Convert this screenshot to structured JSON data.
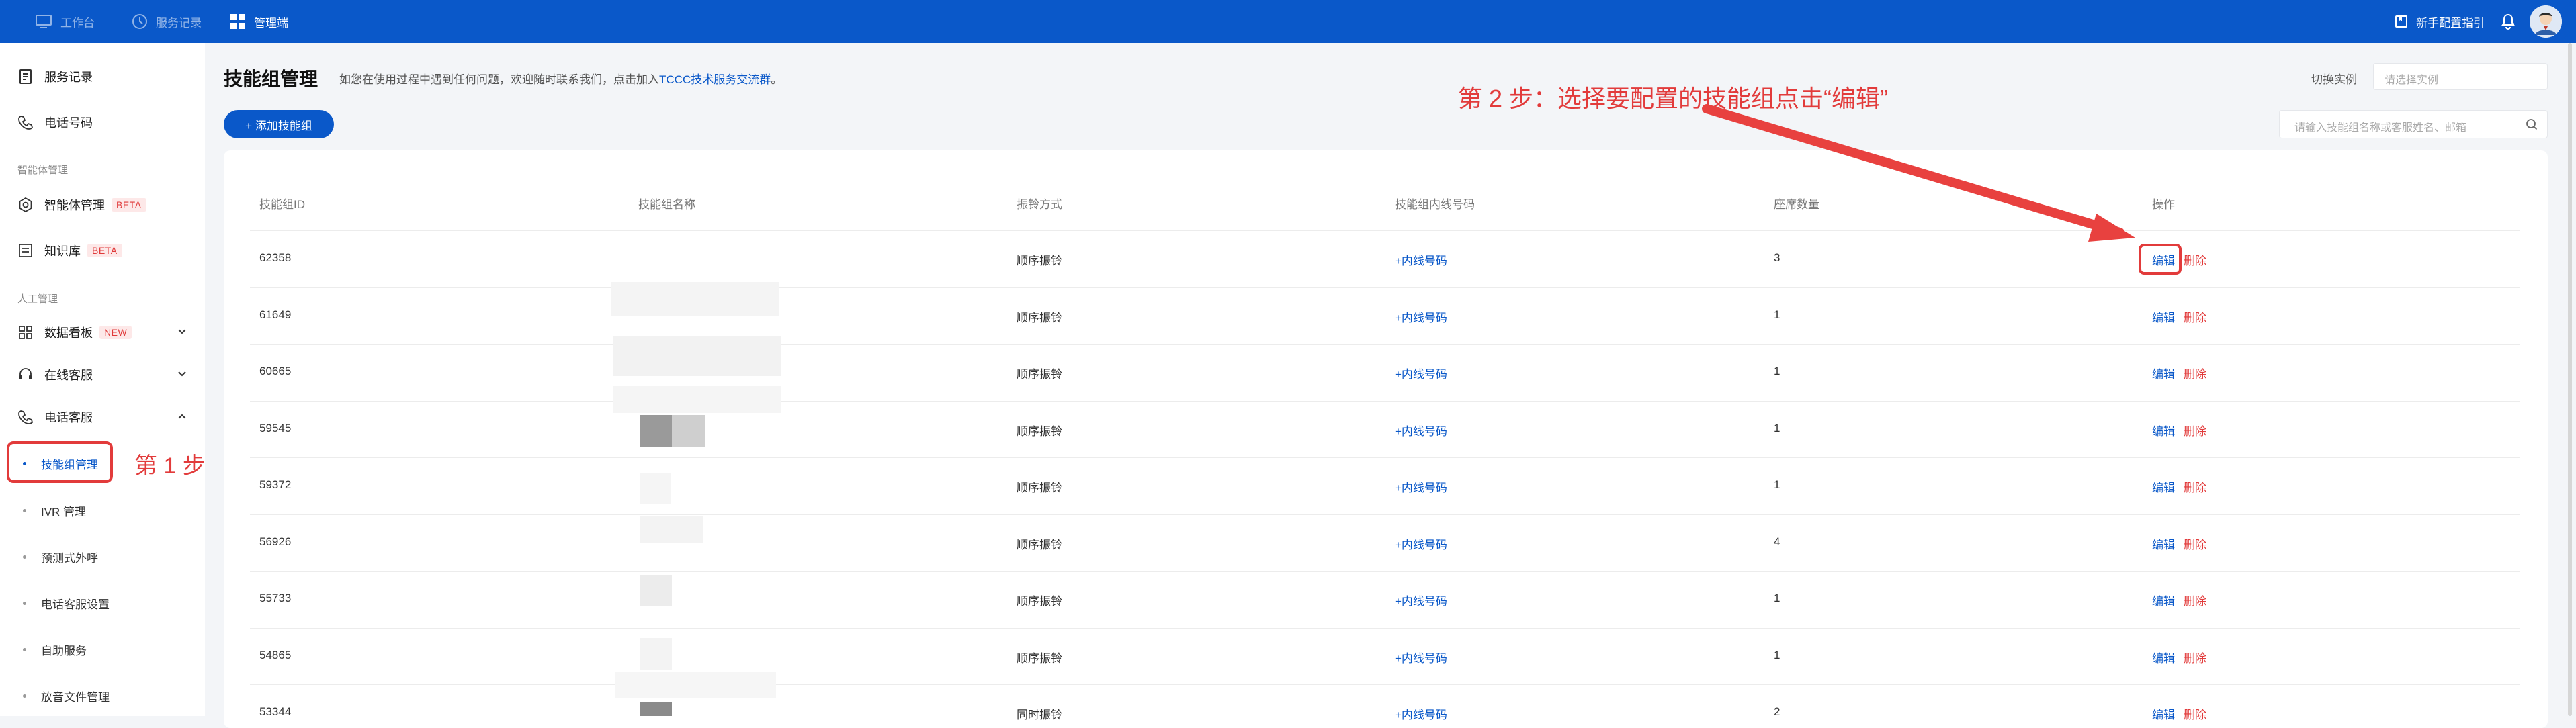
{
  "topbar": {
    "nav": [
      {
        "label": "工作台"
      },
      {
        "label": "服务记录"
      },
      {
        "label": "管理端"
      }
    ],
    "guide_label": "新手配置指引",
    "accent": "#0a58c9"
  },
  "sidebar": {
    "items_top": [
      {
        "label": "服务记录",
        "icon": "document-icon"
      },
      {
        "label": "电话号码",
        "icon": "phone-icon"
      }
    ],
    "section_agent": "智能体管理",
    "agent_items": [
      {
        "label": "智能体管理",
        "badge": "BETA"
      },
      {
        "label": "知识库",
        "badge": "BETA"
      }
    ],
    "section_manual": "人工管理",
    "manual_items": [
      {
        "label": "数据看板",
        "badge": "NEW"
      },
      {
        "label": "在线客服"
      },
      {
        "label": "电话客服"
      }
    ],
    "sub_items": [
      {
        "label": "技能组管理"
      },
      {
        "label": "IVR 管理"
      },
      {
        "label": "预测式外呼"
      },
      {
        "label": "电话客服设置"
      },
      {
        "label": "自助服务"
      },
      {
        "label": "放音文件管理"
      }
    ],
    "step1": "第 1 步"
  },
  "main": {
    "title": "技能组管理",
    "desc_prefix": "如您在使用过程中遇到任何问题，欢迎随时联系我们，点击加入",
    "desc_link": "TCCC技术服务交流群",
    "desc_suffix": "。",
    "switch_label": "切换实例",
    "instance_placeholder": "请选择实例",
    "add_button": "+ 添加技能组",
    "search_placeholder": "请输入技能组名称或客服姓名、邮箱",
    "step2": "第 2 步：选择要配置的技能组点击“编辑”",
    "columns": [
      "技能组ID",
      "技能组名称",
      "振铃方式",
      "技能组内线号码",
      "座席数量",
      "操作"
    ],
    "rows": [
      {
        "id": "62358",
        "ring": "顺序振铃",
        "ext": "+内线号码",
        "seats": "3",
        "edit": "编辑",
        "del": "删除"
      },
      {
        "id": "61649",
        "ring": "顺序振铃",
        "ext": "+内线号码",
        "seats": "1",
        "edit": "编辑",
        "del": "删除"
      },
      {
        "id": "60665",
        "ring": "顺序振铃",
        "ext": "+内线号码",
        "seats": "1",
        "edit": "编辑",
        "del": "删除"
      },
      {
        "id": "59545",
        "ring": "顺序振铃",
        "ext": "+内线号码",
        "seats": "1",
        "edit": "编辑",
        "del": "删除"
      },
      {
        "id": "59372",
        "ring": "顺序振铃",
        "ext": "+内线号码",
        "seats": "1",
        "edit": "编辑",
        "del": "删除"
      },
      {
        "id": "56926",
        "ring": "顺序振铃",
        "ext": "+内线号码",
        "seats": "4",
        "edit": "编辑",
        "del": "删除"
      },
      {
        "id": "55733",
        "ring": "顺序振铃",
        "ext": "+内线号码",
        "seats": "1",
        "edit": "编辑",
        "del": "删除"
      },
      {
        "id": "54865",
        "ring": "顺序振铃",
        "ext": "+内线号码",
        "seats": "1",
        "edit": "编辑",
        "del": "删除"
      },
      {
        "id": "53344",
        "ring": "同时振铃",
        "ext": "+内线号码",
        "seats": "2",
        "edit": "编辑",
        "del": "删除"
      }
    ]
  }
}
